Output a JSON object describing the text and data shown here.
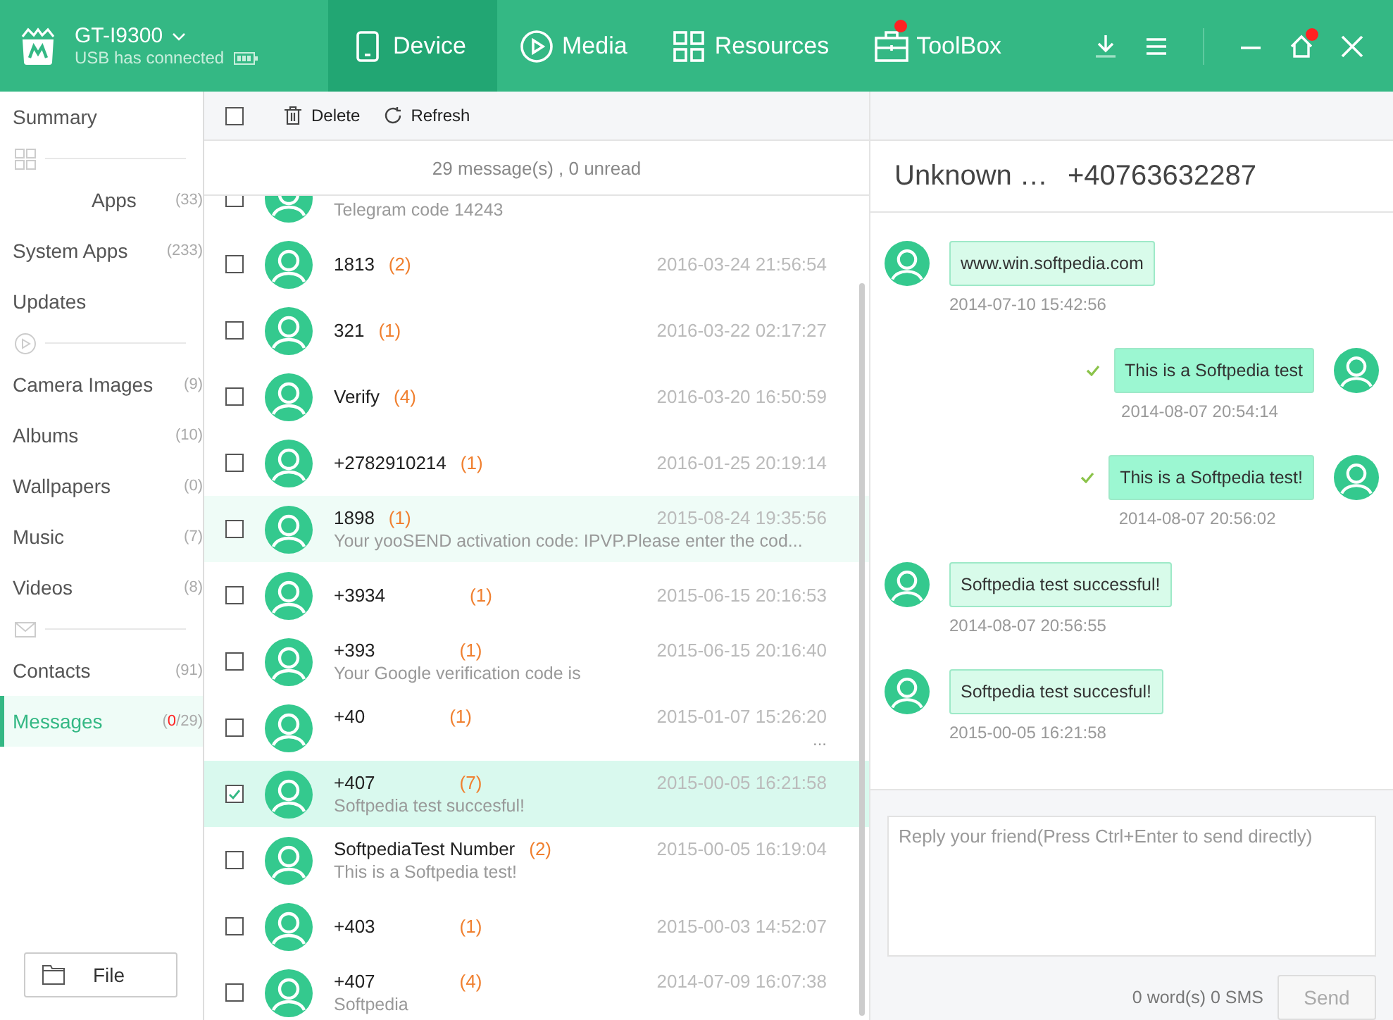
{
  "device": {
    "name": "GT-I9300",
    "status": "USB has connected"
  },
  "tabs": [
    {
      "label": "Device",
      "kind": "device",
      "selected": true,
      "badge": false
    },
    {
      "label": "Media",
      "kind": "media",
      "selected": false,
      "badge": false
    },
    {
      "label": "Resources",
      "kind": "resources",
      "selected": false,
      "badge": false
    },
    {
      "label": "ToolBox",
      "kind": "toolbox",
      "selected": false,
      "badge": true
    }
  ],
  "window_controls": {
    "home_badge": true
  },
  "sidebar": {
    "items": [
      {
        "kind": "item",
        "label": "Summary",
        "selected": false
      },
      {
        "kind": "section"
      },
      {
        "kind": "item",
        "label": "Apps",
        "count": "(33)",
        "selected": false,
        "centered": true
      },
      {
        "kind": "item",
        "label": "System Apps",
        "count": "(233)",
        "selected": false
      },
      {
        "kind": "item",
        "label": "Updates",
        "selected": false
      },
      {
        "kind": "section"
      },
      {
        "kind": "item",
        "label": "Camera Images",
        "count": "(9)",
        "selected": false
      },
      {
        "kind": "item",
        "label": "Albums",
        "count": "(10)",
        "selected": false
      },
      {
        "kind": "item",
        "label": "Wallpapers",
        "count": "(0)",
        "selected": false
      },
      {
        "kind": "item",
        "label": "Music",
        "count": "(7)",
        "selected": false
      },
      {
        "kind": "item",
        "label": "Videos",
        "count": "(8)",
        "selected": false
      },
      {
        "kind": "section"
      },
      {
        "kind": "item",
        "label": "Contacts",
        "count": "(91)",
        "selected": false
      },
      {
        "kind": "item",
        "label": "Messages",
        "count_open": "(",
        "unread": "0",
        "count_rest": "/29)",
        "selected": true
      }
    ],
    "file_button": "File"
  },
  "toolbar": {
    "select_all_checked": false,
    "delete": "Delete",
    "refresh": "Refresh"
  },
  "summary": "29 message(s) , 0 unread",
  "messages": [
    {
      "preview": "Telegram code 14243",
      "checked": false,
      "highlighted": false
    },
    {
      "name": "1813",
      "count": "(2)",
      "date": "2016-03-24 21:56:54",
      "checked": false,
      "highlighted": false
    },
    {
      "name": "321",
      "count": "(1)",
      "date": "2016-03-22 02:17:27",
      "checked": false,
      "highlighted": false
    },
    {
      "name": "Verify",
      "count": "(4)",
      "date": "2016-03-20 16:50:59",
      "checked": false,
      "highlighted": false
    },
    {
      "name": "+2782910214",
      "count": "(1)",
      "date": "2016-01-25 20:19:14",
      "checked": false,
      "highlighted": false
    },
    {
      "name": "1898",
      "count": "(1)",
      "date": "2015-08-24 19:35:56",
      "preview": "Your yooSEND activation code: IPVP.Please enter the cod...",
      "checked": false,
      "highlighted": true
    },
    {
      "name": "+3934",
      "count": "(1)",
      "date": "2015-06-15 20:16:53",
      "checked": false,
      "highlighted": false,
      "gap": true
    },
    {
      "name": "+393",
      "count": "(1)",
      "date": "2015-06-15 20:16:40",
      "preview": "Your Google verification code is",
      "checked": false,
      "highlighted": false,
      "gap": true
    },
    {
      "name": "+40",
      "count": "(1)",
      "date": "2015-01-07 15:26:20",
      "tail": "...",
      "checked": false,
      "highlighted": false,
      "gap": true
    },
    {
      "name": "+407",
      "count": "(7)",
      "date": "2015-00-05 16:21:58",
      "preview": "Softpedia test succesful!",
      "checked": true,
      "highlighted": false,
      "gap": true
    },
    {
      "name": "SoftpediaTest Number",
      "count": "(2)",
      "date": "2015-00-05 16:19:04",
      "preview": "This is a Softpedia test!",
      "checked": false,
      "highlighted": false
    },
    {
      "name": "+403",
      "count": "(1)",
      "date": "2015-00-03 14:52:07",
      "checked": false,
      "highlighted": false,
      "gap": true
    },
    {
      "name": "+407",
      "count": "(4)",
      "date": "2014-07-09 16:07:38",
      "preview": "Softpedia",
      "checked": false,
      "highlighted": false,
      "gap": true
    }
  ],
  "conversation": {
    "title": "Unknown …",
    "number": "+40763632287",
    "items": [
      {
        "kind": "received",
        "text": "www.win.softpedia.com",
        "time": "2014-07-10 15:42:56",
        "delivered": false
      },
      {
        "kind": "sent",
        "text": "This is a Softpedia test",
        "time": "2014-08-07 20:54:14",
        "delivered": true
      },
      {
        "kind": "sent",
        "text": "This is a Softpedia test!",
        "time": "2014-08-07 20:56:02",
        "delivered": true
      },
      {
        "kind": "received",
        "text": "Softpedia test successful!",
        "time": "2014-08-07 20:56:55",
        "delivered": false
      },
      {
        "kind": "received",
        "text": "Softpedia test succesful!",
        "time": "2015-00-05 16:21:58",
        "delivered": false
      }
    ],
    "reply_placeholder": "Reply your friend(Press Ctrl+Enter to send directly)",
    "counter": "0 word(s) 0 SMS",
    "send": "Send"
  }
}
